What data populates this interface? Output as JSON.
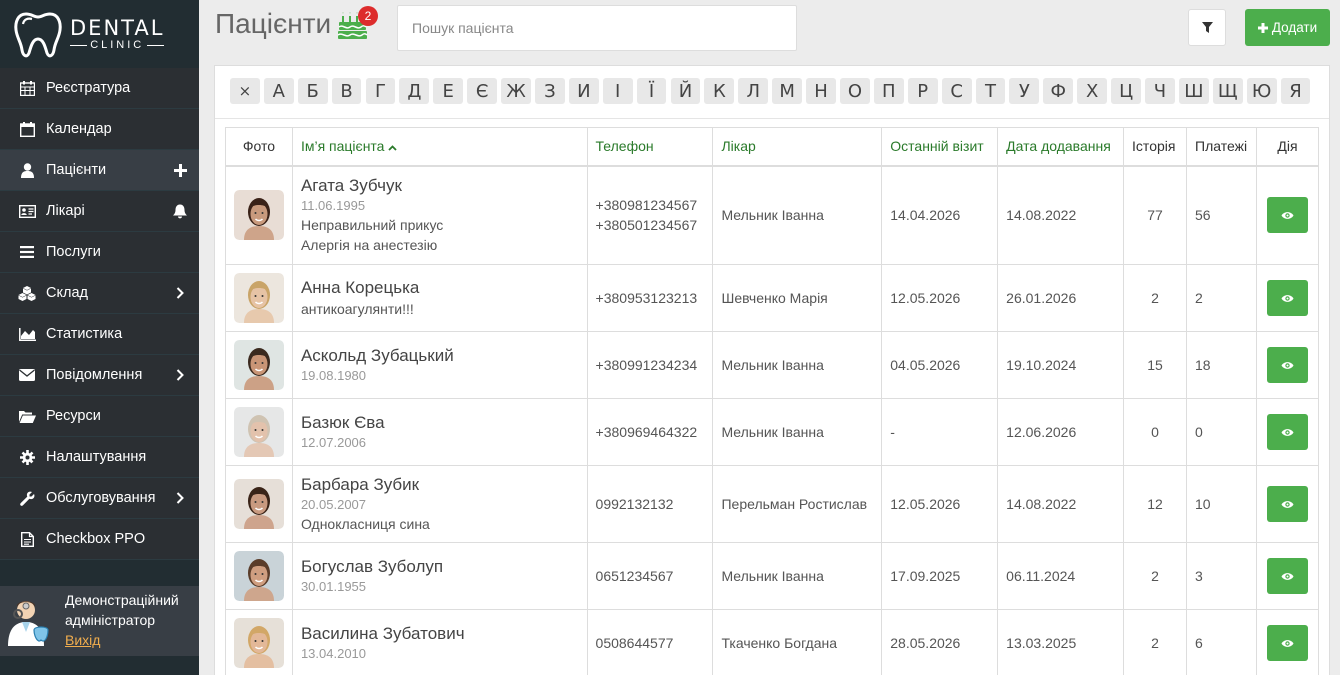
{
  "logo": {
    "line1": "DENTAL",
    "line2": "CLINIC"
  },
  "sidebar": {
    "items": [
      {
        "label": "Реєстратура",
        "icon": "calendar-grid-icon"
      },
      {
        "label": "Календар",
        "icon": "calendar-icon"
      },
      {
        "label": "Пацієнти",
        "icon": "user-icon",
        "right_icon": "plus-icon",
        "active": true
      },
      {
        "label": "Лікарі",
        "icon": "id-card-icon",
        "right_icon": "bell-icon"
      },
      {
        "label": "Послуги",
        "icon": "list-icon"
      },
      {
        "label": "Склад",
        "icon": "cubes-icon",
        "right_icon": "chevron-right-icon"
      },
      {
        "label": "Статистика",
        "icon": "area-chart-icon"
      },
      {
        "label": "Повідомлення",
        "icon": "envelope-icon",
        "right_icon": "chevron-right-icon"
      },
      {
        "label": "Ресурси",
        "icon": "folder-open-icon"
      },
      {
        "label": "Налаштування",
        "icon": "gear-icon"
      },
      {
        "label": "Обслуговування",
        "icon": "wrench-icon",
        "right_icon": "chevron-right-icon"
      },
      {
        "label": "Checkbox PPO",
        "icon": "file-icon"
      }
    ]
  },
  "user": {
    "name_line1": "Демонстраційний",
    "name_line2": "адміністратор",
    "logout": "Вихід"
  },
  "header": {
    "title": "Пацієнти",
    "birthday_badge": "2",
    "search_placeholder": "Пошук пацієнта",
    "add_label": "Додати"
  },
  "alphabet": [
    "×",
    "А",
    "Б",
    "В",
    "Г",
    "Д",
    "Е",
    "Є",
    "Ж",
    "З",
    "И",
    "І",
    "Ї",
    "Й",
    "К",
    "Л",
    "М",
    "Н",
    "О",
    "П",
    "Р",
    "С",
    "Т",
    "У",
    "Ф",
    "Х",
    "Ц",
    "Ч",
    "Ш",
    "Щ",
    "Ю",
    "Я"
  ],
  "table": {
    "headers": {
      "photo": "Фото",
      "name": "Ім’я пацієнта",
      "phone": "Телефон",
      "doctor": "Лікар",
      "last_visit": "Останній візит",
      "added": "Дата додавання",
      "history": "Історія",
      "payments": "Платежі",
      "action": "Дія"
    },
    "rows": [
      {
        "name": "Агата Зубчук",
        "birth": "11.06.1995",
        "notes": [
          "Неправильний прикус",
          "Алергія на анестезію"
        ],
        "phones": [
          "+380981234567",
          "+380501234567"
        ],
        "doctor": "Мельник Іванна",
        "last_visit": "14.04.2026",
        "added": "14.08.2022",
        "history": "77",
        "payments": "56",
        "avatar": {
          "skin": "#c99a7d",
          "hair": "#3a2218",
          "bg": "#e8ddd5"
        }
      },
      {
        "name": "Анна Корецька",
        "birth": "",
        "notes": [
          "антикоагулянти!!!"
        ],
        "phones": [
          "+380953123213"
        ],
        "doctor": "Шевченко Марія",
        "last_visit": "12.05.2026",
        "added": "26.01.2026",
        "history": "2",
        "payments": "2",
        "avatar": {
          "skin": "#e6c3a5",
          "hair": "#c9a468",
          "bg": "#ece6de"
        }
      },
      {
        "name": "Аскольд Зубацький",
        "birth": "19.08.1980",
        "notes": [],
        "phones": [
          "+380991234234"
        ],
        "doctor": "Мельник Іванна",
        "last_visit": "04.05.2026",
        "added": "19.10.2024",
        "history": "15",
        "payments": "18",
        "avatar": {
          "skin": "#c99576",
          "hair": "#3b2a1f",
          "bg": "#dfe5e3"
        }
      },
      {
        "name": "Базюк Єва",
        "birth": "12.07.2006",
        "notes": [],
        "phones": [
          "+380969464322"
        ],
        "doctor": "Мельник Іванна",
        "last_visit": "-",
        "added": "12.06.2026",
        "history": "0",
        "payments": "0",
        "avatar": {
          "skin": "#e3c2ac",
          "hair": "#cfc3b2",
          "bg": "#e6e7e7"
        }
      },
      {
        "name": "Барбара Зубик",
        "birth": "20.05.2007",
        "notes": [
          "Однокласниця сина"
        ],
        "phones": [
          "0992132132"
        ],
        "doctor": "Перельман Ростислав",
        "last_visit": "12.05.2026",
        "added": "14.08.2022",
        "history": "12",
        "payments": "10",
        "avatar": {
          "skin": "#c99a80",
          "hair": "#3a2418",
          "bg": "#e6dfd8"
        }
      },
      {
        "name": "Богуслав Зуболуп",
        "birth": "30.01.1955",
        "notes": [],
        "phones": [
          "0651234567"
        ],
        "doctor": "Мельник Іванна",
        "last_visit": "17.09.2025",
        "added": "06.11.2024",
        "history": "2",
        "payments": "3",
        "avatar": {
          "skin": "#cf9e80",
          "hair": "#5a3d2a",
          "bg": "#c9d3d8"
        }
      },
      {
        "name": "Василина Зубатович",
        "birth": "13.04.2010",
        "notes": [],
        "phones": [
          "0508644577"
        ],
        "doctor": "Ткаченко Богдана",
        "last_visit": "28.05.2026",
        "added": "13.03.2025",
        "history": "2",
        "payments": "6",
        "avatar": {
          "skin": "#e3b898",
          "hair": "#d2a767",
          "bg": "#e6e0d8"
        }
      }
    ]
  },
  "colors": {
    "sidebar_bg": "#222d32",
    "accent_green": "#4cae4c",
    "header_green": "#2a7a2a",
    "badge_red": "#dd2c2c"
  }
}
